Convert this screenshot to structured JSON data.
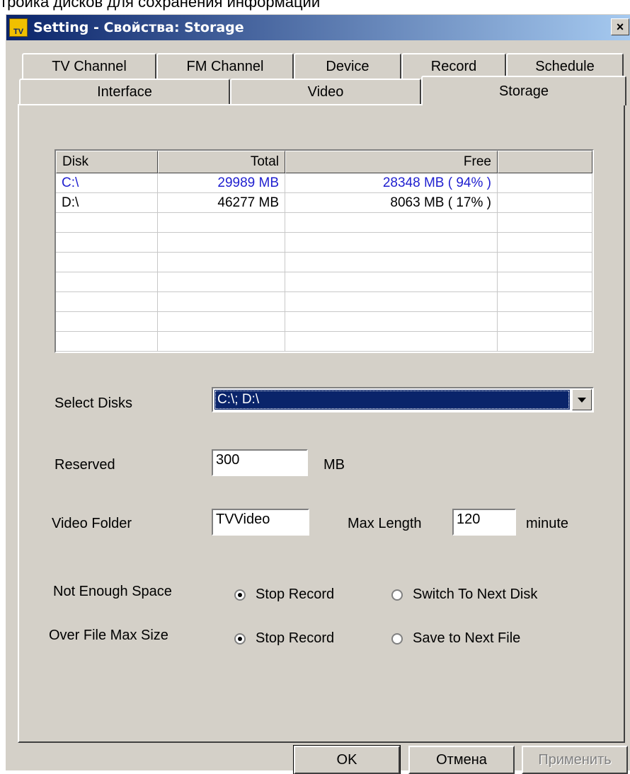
{
  "caption": "тройка дисков для сохранения информации",
  "window": {
    "title": "Setting - Свойства: Storage",
    "icon_text": "TV",
    "close_label": "×"
  },
  "tabs": {
    "row_top": [
      "TV Channel",
      "FM Channel",
      "Device",
      "Record",
      "Schedule"
    ],
    "row_bottom": [
      "Interface",
      "Video",
      "Storage"
    ],
    "active": "Storage"
  },
  "disk_table": {
    "headers": [
      "Disk",
      "Total",
      "Free",
      ""
    ],
    "rows": [
      {
        "disk": "C:\\",
        "total": "29989 MB",
        "free": "28348 MB ( 94% )",
        "selected": true
      },
      {
        "disk": "D:\\",
        "total": "46277 MB",
        "free": "8063 MB ( 17% )",
        "selected": false
      }
    ]
  },
  "form": {
    "select_disks_label": "Select Disks",
    "select_disks_value": "C:\\; D:\\",
    "reserved_label": "Reserved",
    "reserved_value": "300",
    "reserved_unit": "MB",
    "video_folder_label": "Video Folder",
    "video_folder_value": "TVVideo",
    "max_length_label": "Max Length",
    "max_length_value": "120",
    "max_length_unit": "minute",
    "not_enough_space_label": "Not Enough Space",
    "not_enough_space_opt1": "Stop Record",
    "not_enough_space_opt2": "Switch To Next Disk",
    "over_file_max_label": "Over File Max Size",
    "over_file_max_opt1": "Stop Record",
    "over_file_max_opt2": "Save to Next File"
  },
  "buttons": {
    "ok": "OK",
    "cancel": "Отмена",
    "apply": "Применить"
  }
}
